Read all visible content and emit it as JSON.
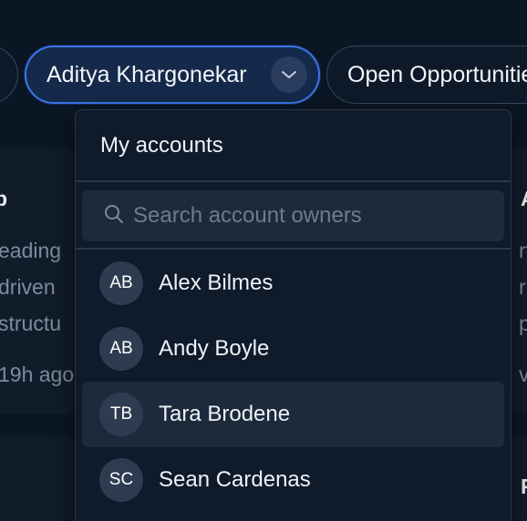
{
  "filters": {
    "owner_label": "Aditya Khargonekar",
    "open_label": "Open Opportunities"
  },
  "dropdown": {
    "header": "My accounts",
    "search": {
      "value": "",
      "placeholder": "Search account owners"
    },
    "items": [
      {
        "initials": "AB",
        "name": "Alex Bilmes"
      },
      {
        "initials": "AB",
        "name": "Andy Boyle"
      },
      {
        "initials": "TB",
        "name": "Tara Brodene"
      },
      {
        "initials": "SC",
        "name": "Sean Cardenas"
      }
    ]
  },
  "background": {
    "left_card": {
      "title": "p",
      "line1": "eading",
      "line2": "driven",
      "line3": "structu",
      "time": "19h ago"
    },
    "right_card": {
      "title": "A",
      "line1": "rt",
      "line2": "r",
      "line3": "p",
      "time": "v"
    },
    "right_card2": {
      "title": "F"
    }
  },
  "colors": {
    "background": "#0b1624",
    "accent": "#3b74e8",
    "panel": "#0f1b2a",
    "hover": "#1d2a3c"
  }
}
